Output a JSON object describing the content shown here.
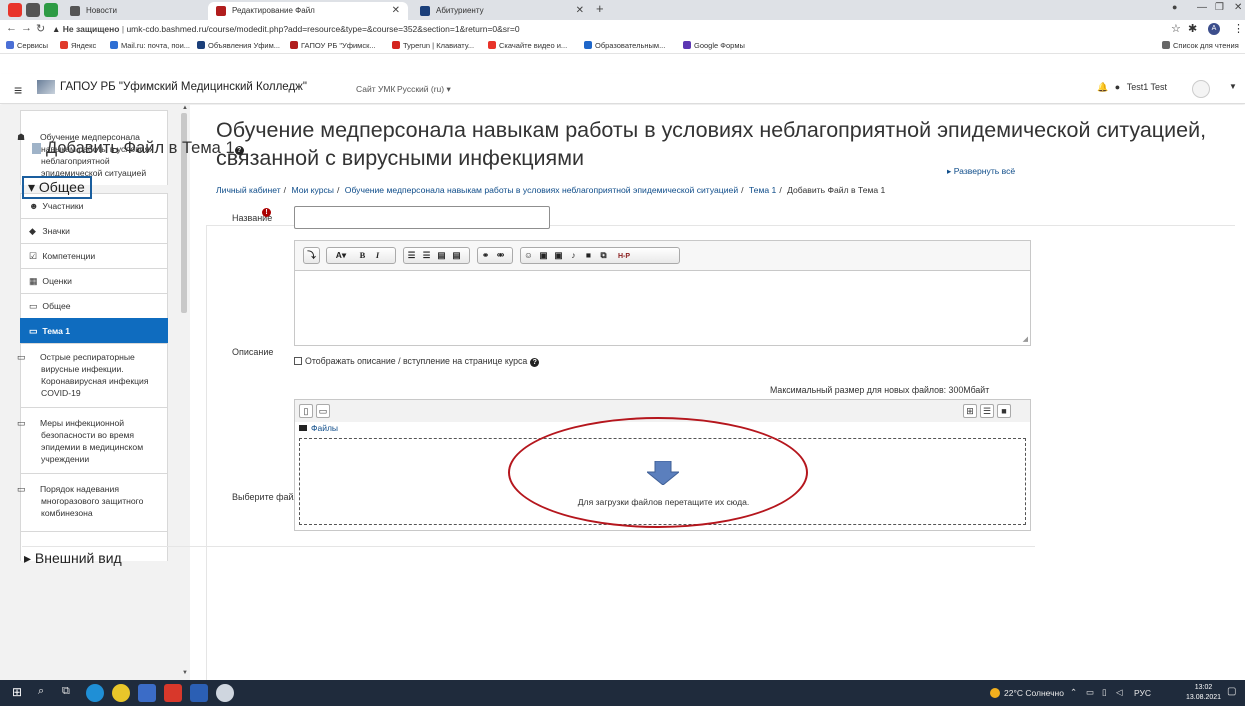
{
  "browser": {
    "tabs": [
      {
        "title": "Новости"
      },
      {
        "title": "Редактирование Файл"
      },
      {
        "title": "Абитуриенту"
      }
    ],
    "address": {
      "security": "Не защищено",
      "url": "umk-cdo.bashmed.ru/course/modedit.php?add=resource&type=&course=352&section=1&return=0&sr=0"
    },
    "bookmarks": [
      {
        "label": "Сервисы",
        "color": "#4b6fd6"
      },
      {
        "label": "Яндекс",
        "color": "#e03a2b"
      },
      {
        "label": "Mail.ru: почта, пои...",
        "color": "#2f6fd4"
      },
      {
        "label": "Объявления Уфим...",
        "color": "#1b3f7a"
      },
      {
        "label": "ГАПОУ РБ \"Уфимск...",
        "color": "#b11d1d"
      },
      {
        "label": "Typerun | Клавиату...",
        "color": "#d4241e"
      },
      {
        "label": "Скачайте видео и...",
        "color": "#e8332a"
      },
      {
        "label": "Образовательным...",
        "color": "#1e66c9"
      },
      {
        "label": "Google Формы",
        "color": "#5c36b3"
      }
    ],
    "reading_list": "Список для чтения"
  },
  "navbar": {
    "site_name": "ГАПОУ РБ \"Уфимский Медицинский Колледж\"",
    "site_link": "Сайт УМК",
    "language": "Русский (ru) ▾",
    "user": "Test1 Test"
  },
  "drawer": {
    "items": [
      {
        "icon": "☗",
        "label": "Обучение медперсонала навыкам работы в условиях неблагоприятной эпидемической ситуацией"
      },
      {
        "icon": "☻",
        "label": "Участники"
      },
      {
        "icon": "◆",
        "label": "Значки"
      },
      {
        "icon": "☑",
        "label": "Компетенции"
      },
      {
        "icon": "▦",
        "label": "Оценки"
      },
      {
        "icon": "▭",
        "label": "Общее"
      },
      {
        "icon": "▭",
        "label": "Тема 1"
      },
      {
        "icon": "▭",
        "label": "Острые респираторные вирусные инфекции. Коронавирусная инфекция COVID-19"
      },
      {
        "icon": "▭",
        "label": "Меры инфекционной безопасности во время эпидемии в медицинском учреждении"
      },
      {
        "icon": "▭",
        "label": "Порядок надевания многоразового защитного комбинезона"
      }
    ]
  },
  "main": {
    "course_title": "Обучение медперсонала навыкам работы в условиях неблагоприятной эпидемической ситуацией, связанной с вирусными инфекциями",
    "breadcrumb": [
      "Личный кабинет",
      "Мои курсы",
      "Обучение медперсонала навыкам работы в условиях неблагоприятной эпидемической ситуацией",
      "Тема 1",
      "Добавить Файл в Тема 1"
    ],
    "page_title": "Добавить Файл в Тема 1",
    "expand_all": "▸ Развернуть всё",
    "section_general": "▾ Общее",
    "label_name": "Название",
    "label_description": "Описание",
    "show_description": "Отображать описание / вступление на странице курса",
    "label_select_files": "Выберите файлы",
    "max_size": "Максимальный размер для новых файлов: 300Мбайт",
    "files_folder": "Файлы",
    "drop_text": "Для загрузки файлов перетащите их сюда.",
    "section_appearance": "▸ Внешний вид",
    "name_value": ""
  },
  "taskbar": {
    "weather": "22°C Солнечно",
    "lang": "РУС",
    "time": "13:02",
    "date": "13.08.2021"
  }
}
